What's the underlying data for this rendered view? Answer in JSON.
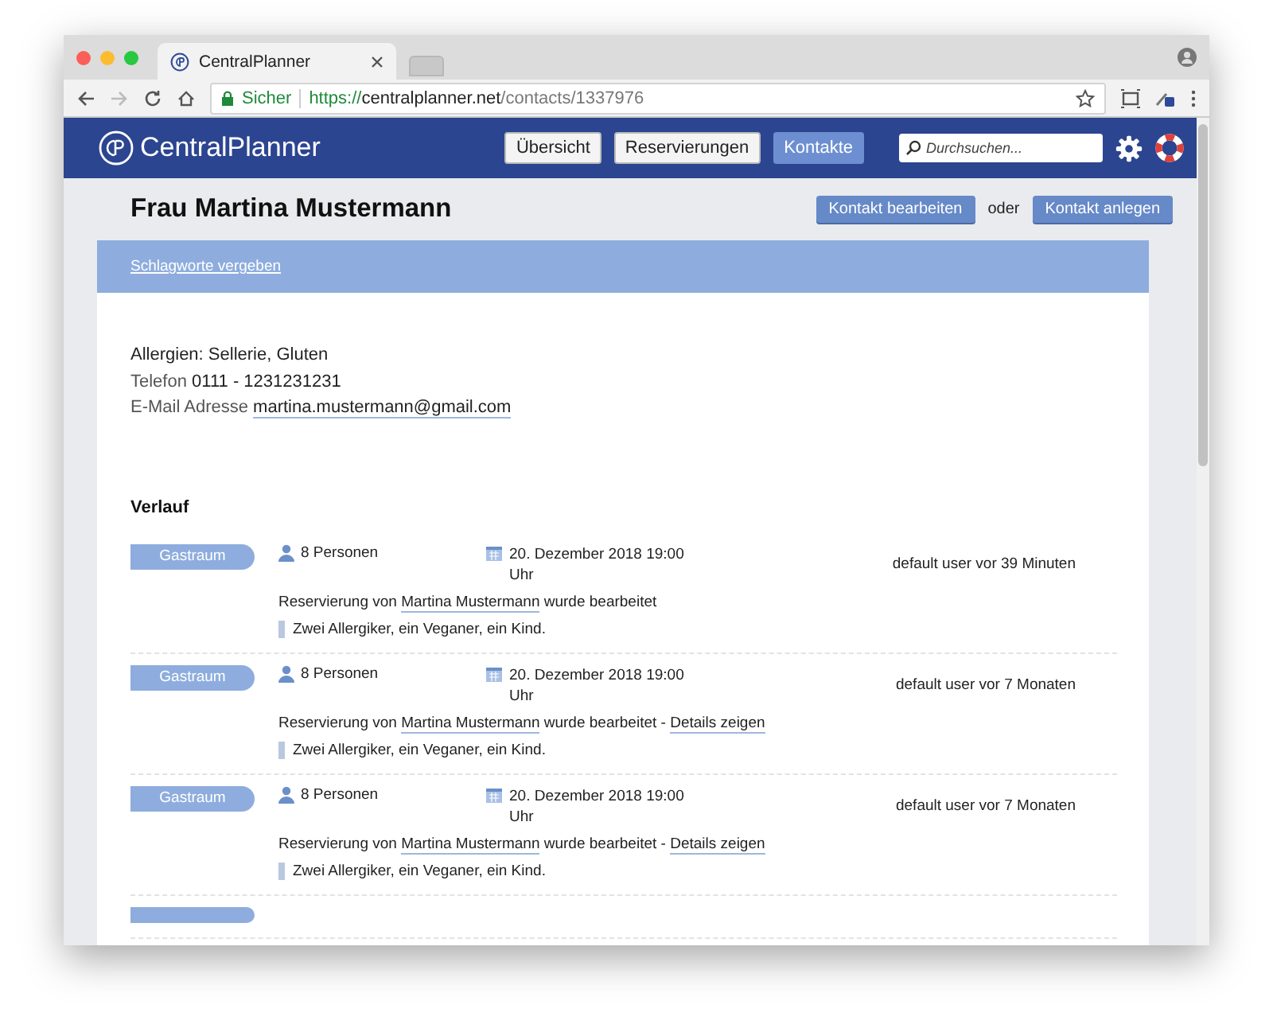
{
  "browser": {
    "tab_title": "CentralPlanner",
    "secure_label": "Sicher",
    "url_scheme": "https://",
    "url_host": "centralplanner.net",
    "url_path": "/contacts/1337976"
  },
  "header": {
    "logo_text": "CentralPlanner",
    "nav": [
      {
        "label": "Übersicht",
        "selected": false
      },
      {
        "label": "Reservierungen",
        "selected": false
      },
      {
        "label": "Kontakte",
        "selected": true
      }
    ],
    "search": {
      "placeholder": "Durchsuchen..."
    }
  },
  "contact": {
    "name": "Frau Martina Mustermann",
    "edit_button": "Kontakt bearbeiten",
    "or_text": "oder",
    "create_button": "Kontakt anlegen",
    "tags_link": "Schlagworte vergeben",
    "allergies": "Allergien: Sellerie, Gluten",
    "phone_label": "Telefon",
    "phone": "0111 - 1231231231",
    "email_label": "E-Mail Adresse",
    "email": "martina.mustermann@gmail.com"
  },
  "history": {
    "title": "Verlauf",
    "entries": [
      {
        "area": "Gastraum",
        "persons": "8 Personen",
        "date": "20. Dezember 2018 19:00 Uhr",
        "author": "default user vor 39 Minuten",
        "action_prefix": "Reservierung von",
        "contact_link": "Martina Mustermann",
        "action_suffix": "wurde bearbeitet",
        "note": "Zwei Allergiker, ein Veganer, ein Kind."
      },
      {
        "area": "Gastraum",
        "persons": "8 Personen",
        "date": "20. Dezember 2018 19:00 Uhr",
        "author": "default user vor 7 Monaten",
        "action_prefix": "Reservierung von",
        "contact_link": "Martina Mustermann",
        "action_suffix": "wurde bearbeitet",
        "details_separator": "-",
        "details_link": "Details zeigen",
        "note": "Zwei Allergiker, ein Veganer, ein Kind."
      },
      {
        "area": "Gastraum",
        "persons": "8 Personen",
        "date": "20. Dezember 2018 19:00 Uhr",
        "author": "default user vor 7 Monaten",
        "action_prefix": "Reservierung von",
        "contact_link": "Martina Mustermann",
        "action_suffix": "wurde bearbeitet",
        "details_separator": "-",
        "details_link": "Details zeigen",
        "note": "Zwei Allergiker, ein Veganer, ein Kind."
      }
    ]
  }
}
